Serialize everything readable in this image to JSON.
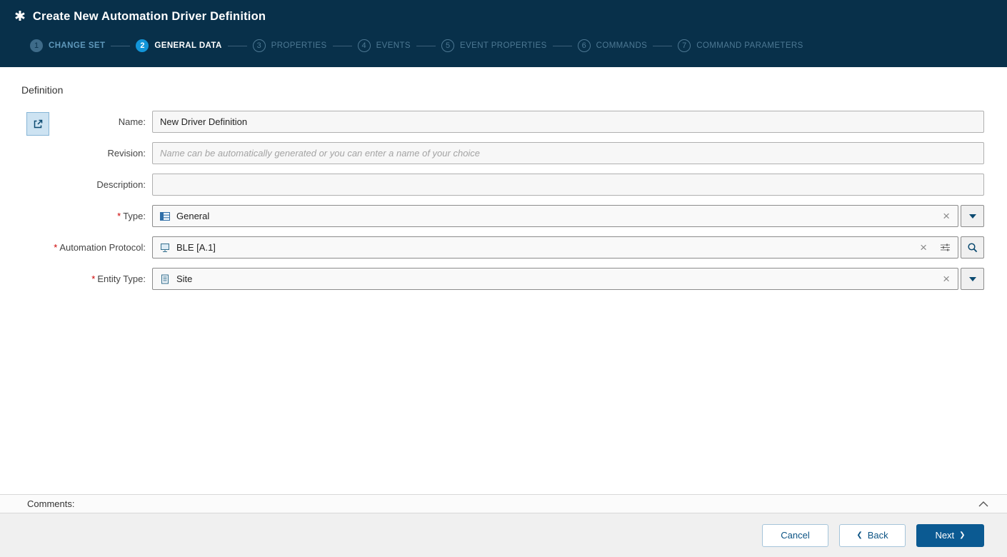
{
  "header": {
    "title": "Create New Automation Driver Definition"
  },
  "icons": {
    "asterisk": "✱",
    "clear": "×",
    "back_chevron": "❮",
    "next_chevron": "❯"
  },
  "wizard": {
    "steps": [
      {
        "number": "1",
        "label": "CHANGE SET",
        "state": "completed"
      },
      {
        "number": "2",
        "label": "GENERAL DATA",
        "state": "active"
      },
      {
        "number": "3",
        "label": "PROPERTIES",
        "state": "upcoming"
      },
      {
        "number": "4",
        "label": "EVENTS",
        "state": "upcoming"
      },
      {
        "number": "5",
        "label": "EVENT PROPERTIES",
        "state": "upcoming"
      },
      {
        "number": "6",
        "label": "COMMANDS",
        "state": "upcoming"
      },
      {
        "number": "7",
        "label": "COMMAND PARAMETERS",
        "state": "upcoming"
      }
    ]
  },
  "form": {
    "section_title": "Definition",
    "required_marker": "*",
    "fields": {
      "name": {
        "label": "Name:",
        "value": "New Driver Definition"
      },
      "revision": {
        "label": "Revision:",
        "value": "",
        "placeholder": "Name can be automatically generated or you can enter a name of your choice"
      },
      "description": {
        "label": "Description:",
        "value": ""
      },
      "type": {
        "label": "Type:",
        "value": "General"
      },
      "automation_protocol": {
        "label": "Automation Protocol:",
        "value": "BLE [A.1]"
      },
      "entity_type": {
        "label": "Entity Type:",
        "value": "Site"
      }
    }
  },
  "comments": {
    "label": "Comments:"
  },
  "footer": {
    "cancel_label": "Cancel",
    "back_label": "Back",
    "next_label": "Next"
  },
  "colors": {
    "header_bg": "#08304a",
    "active_step": "#1295d8",
    "accent": "#0b5a92",
    "required": "#cc0000"
  }
}
